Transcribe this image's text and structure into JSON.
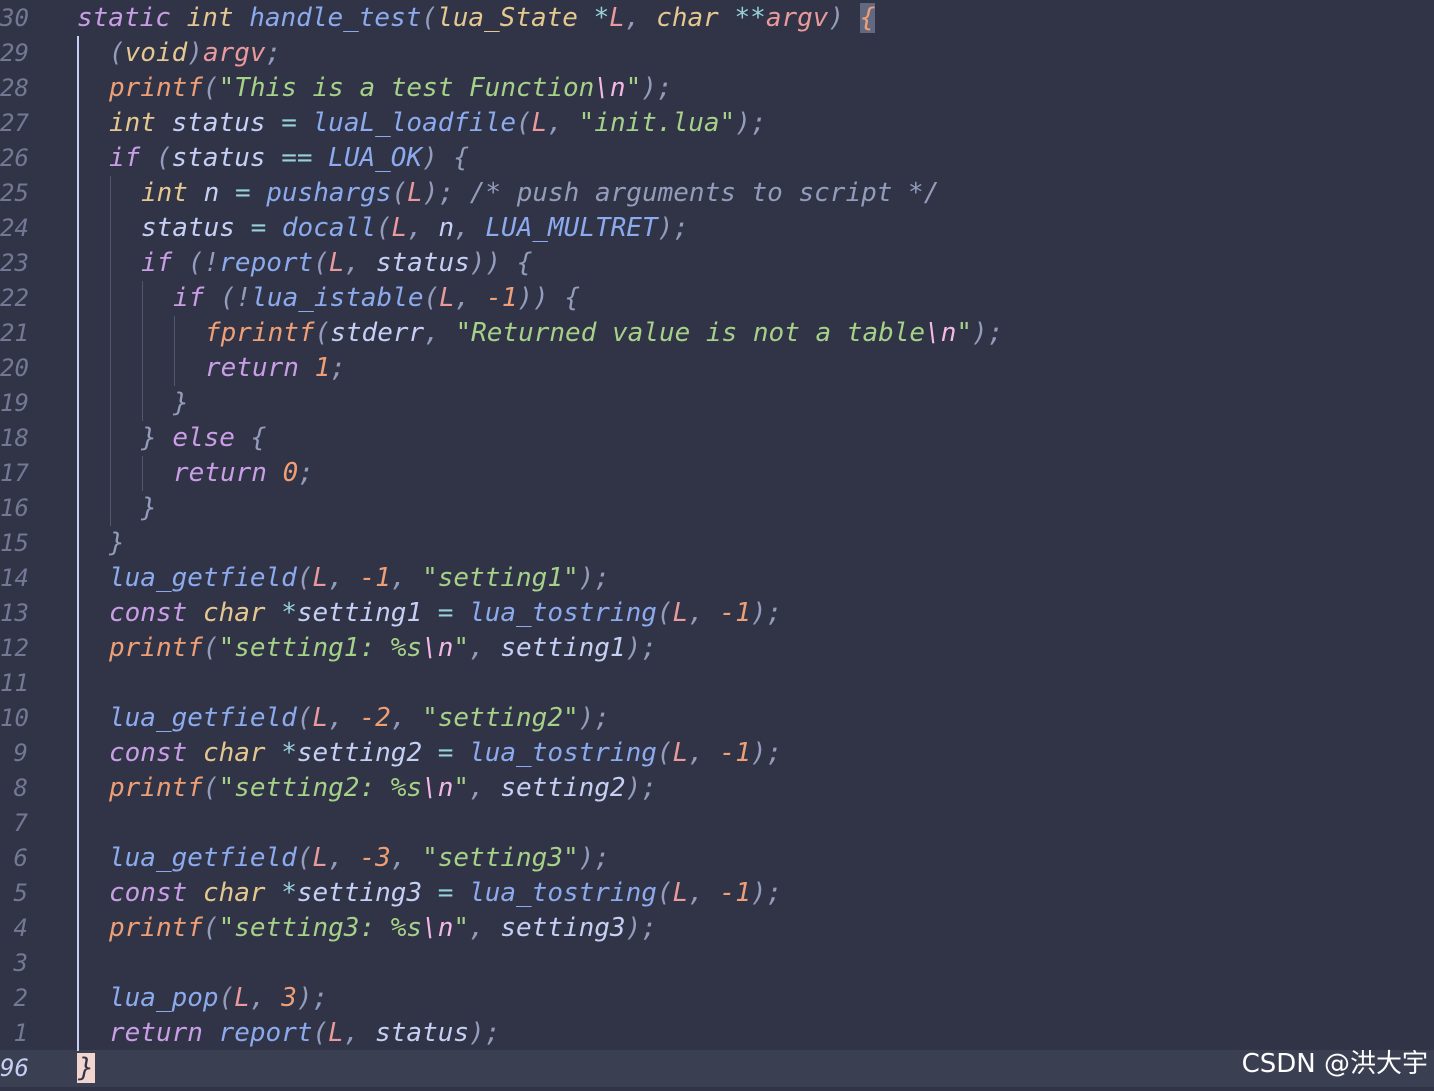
{
  "gutter": {
    "line_numbers": [
      "30",
      "29",
      "28",
      "27",
      "26",
      "25",
      "24",
      "23",
      "22",
      "21",
      "20",
      "19",
      "18",
      "17",
      "16",
      "15",
      "14",
      "13",
      "12",
      "11",
      "10",
      "9",
      "8",
      "7",
      "6",
      "5",
      "4",
      "3",
      "2",
      "1",
      "96"
    ]
  },
  "code": {
    "l1": [
      "static",
      "int",
      "handle_test",
      "(",
      "lua_State",
      "*",
      "L",
      ",",
      "char",
      "**",
      "argv",
      ")",
      "{"
    ],
    "l2": [
      "(",
      "void",
      ")",
      "argv",
      ";"
    ],
    "l3": [
      "printf",
      "(",
      "\"This is a test Function",
      "\\n",
      "\"",
      ");"
    ],
    "l4": [
      "int",
      "status",
      "=",
      "luaL_loadfile",
      "(",
      "L",
      ",",
      "\"init.lua\"",
      ");"
    ],
    "l5": [
      "if",
      "(",
      "status",
      "==",
      "LUA_OK",
      ")",
      "{"
    ],
    "l6": [
      "int",
      "n",
      "=",
      "pushargs",
      "(",
      "L",
      ");",
      "/* push arguments to script */"
    ],
    "l7": [
      "status",
      "=",
      "docall",
      "(",
      "L",
      ",",
      "n",
      ",",
      "LUA_MULTRET",
      ");"
    ],
    "l8": [
      "if",
      "(!",
      "report",
      "(",
      "L",
      ",",
      "status",
      "))",
      "{"
    ],
    "l9": [
      "if",
      "(!",
      "lua_istable",
      "(",
      "L",
      ",",
      "-1",
      "))",
      "{"
    ],
    "l10": [
      "fprintf",
      "(",
      "stderr",
      ",",
      "\"Returned value is not a table",
      "\\n",
      "\"",
      ");"
    ],
    "l11": [
      "return",
      "1",
      ";"
    ],
    "l12": [
      "}"
    ],
    "l13": [
      "}",
      "else",
      "{"
    ],
    "l14": [
      "return",
      "0",
      ";"
    ],
    "l15": [
      "}"
    ],
    "l16": [
      "}"
    ],
    "l17": [
      "lua_getfield",
      "(",
      "L",
      ",",
      "-1",
      ",",
      "\"setting1\"",
      ");"
    ],
    "l18": [
      "const",
      "char",
      "*",
      "setting1",
      "=",
      "lua_tostring",
      "(",
      "L",
      ",",
      "-1",
      ");"
    ],
    "l19": [
      "printf",
      "(",
      "\"setting1: %s",
      "\\n",
      "\"",
      ",",
      "setting1",
      ");"
    ],
    "l21": [
      "lua_getfield",
      "(",
      "L",
      ",",
      "-2",
      ",",
      "\"setting2\"",
      ");"
    ],
    "l22": [
      "const",
      "char",
      "*",
      "setting2",
      "=",
      "lua_tostring",
      "(",
      "L",
      ",",
      "-1",
      ");"
    ],
    "l23": [
      "printf",
      "(",
      "\"setting2: %s",
      "\\n",
      "\"",
      ",",
      "setting2",
      ");"
    ],
    "l25": [
      "lua_getfield",
      "(",
      "L",
      ",",
      "-3",
      ",",
      "\"setting3\"",
      ");"
    ],
    "l26": [
      "const",
      "char",
      "*",
      "setting3",
      "=",
      "lua_tostring",
      "(",
      "L",
      ",",
      "-1",
      ");"
    ],
    "l27": [
      "printf",
      "(",
      "\"setting3: %s",
      "\\n",
      "\"",
      ",",
      "setting3",
      ");"
    ],
    "l29": [
      "lua_pop",
      "(",
      "L",
      ",",
      "3",
      ");"
    ],
    "l30": [
      "return",
      "report",
      "(",
      "L",
      ",",
      "status",
      ");"
    ],
    "l31": [
      "}"
    ]
  },
  "watermark": "CSDN @洪大宇",
  "colors": {
    "background": "#303446",
    "cursorline": "#3b3f52",
    "keyword": "#ca9ee6",
    "type": "#e5c890",
    "function": "#8caaee",
    "string": "#a6d189",
    "number": "#ef9f76",
    "parameter": "#ea999c",
    "comment": "#949cbb"
  }
}
